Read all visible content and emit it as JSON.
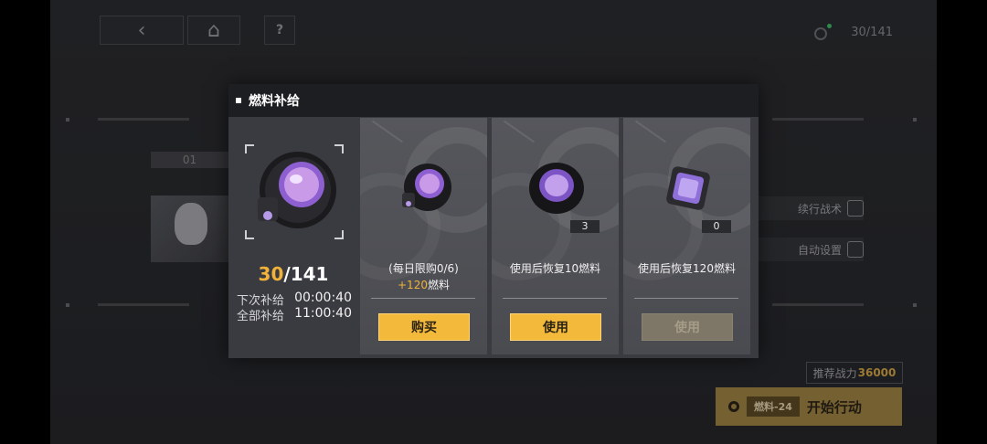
{
  "top_bar": {
    "back_icon": "back-arrow-icon",
    "home_icon": "home-icon",
    "help_label": "?",
    "fuel_display": "30/141"
  },
  "background": {
    "stage_label": "01",
    "side_buttons": [
      {
        "label": "续行战术",
        "icon": "gear-icon"
      },
      {
        "label": "自动设置",
        "icon": "bulb-icon"
      }
    ],
    "power_label": "推荐战力",
    "power_value": "36000",
    "fuel_cost": "燃料-24",
    "start_label": "开始行动"
  },
  "dialog": {
    "title": "燃料补给",
    "fuel_current": "30",
    "fuel_sep": "/",
    "fuel_max": "141",
    "next_label": "下次补给",
    "next_time": "00:00:40",
    "full_label": "全部补给",
    "full_time": "11:00:40",
    "cards": [
      {
        "line1": "(每日限购0/6)",
        "bonus": "+120",
        "bonus_unit": "燃料",
        "button": "购买",
        "qty": "",
        "enabled": true
      },
      {
        "line1": "使用后恢复10燃料",
        "bonus": "",
        "bonus_unit": "",
        "button": "使用",
        "qty": "3",
        "enabled": true
      },
      {
        "line1": "使用后恢复120燃料",
        "bonus": "",
        "bonus_unit": "",
        "button": "使用",
        "qty": "0",
        "enabled": false
      }
    ]
  }
}
